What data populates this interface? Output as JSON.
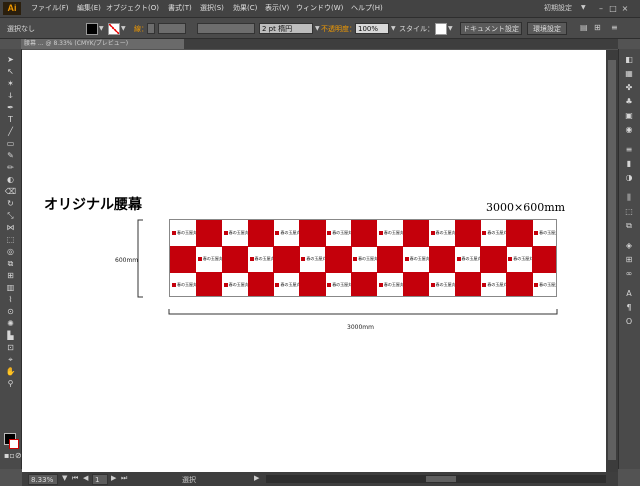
{
  "app": {
    "logo": "Ai",
    "accent_color": "#f29a00"
  },
  "menu": [
    "ファイル(F)",
    "編集(E)",
    "オブジェクト(O)",
    "書式(T)",
    "選択(S)",
    "効果(C)",
    "表示(V)",
    "ウィンドウ(W)",
    "ヘルプ(H)"
  ],
  "workspace": {
    "label": "初期設定",
    "buttons": [
      "–",
      "□",
      "×"
    ]
  },
  "control": {
    "selection_label": "選択なし",
    "stroke_label": "線：",
    "stroke_weight": "2 pt 楕円",
    "opacity_label": "不透明度：",
    "opacity_value": "100%",
    "style_label": "スタイル：",
    "doc_settings_button": "ドキュメント設定",
    "prefs_button": "環境設定"
  },
  "document_tab": "腰幕 ... @ 8.33% (CMYK/プレビュー)",
  "artwork": {
    "title": "オリジナル腰幕",
    "dimensions": "3000×600mm",
    "height_label": "600mm",
    "width_label": "3000mm",
    "logo_text": "春の玉屋丸",
    "banner_color": "#c4000b"
  },
  "status": {
    "zoom": "8.33%",
    "page": "1",
    "tool": "選択"
  }
}
